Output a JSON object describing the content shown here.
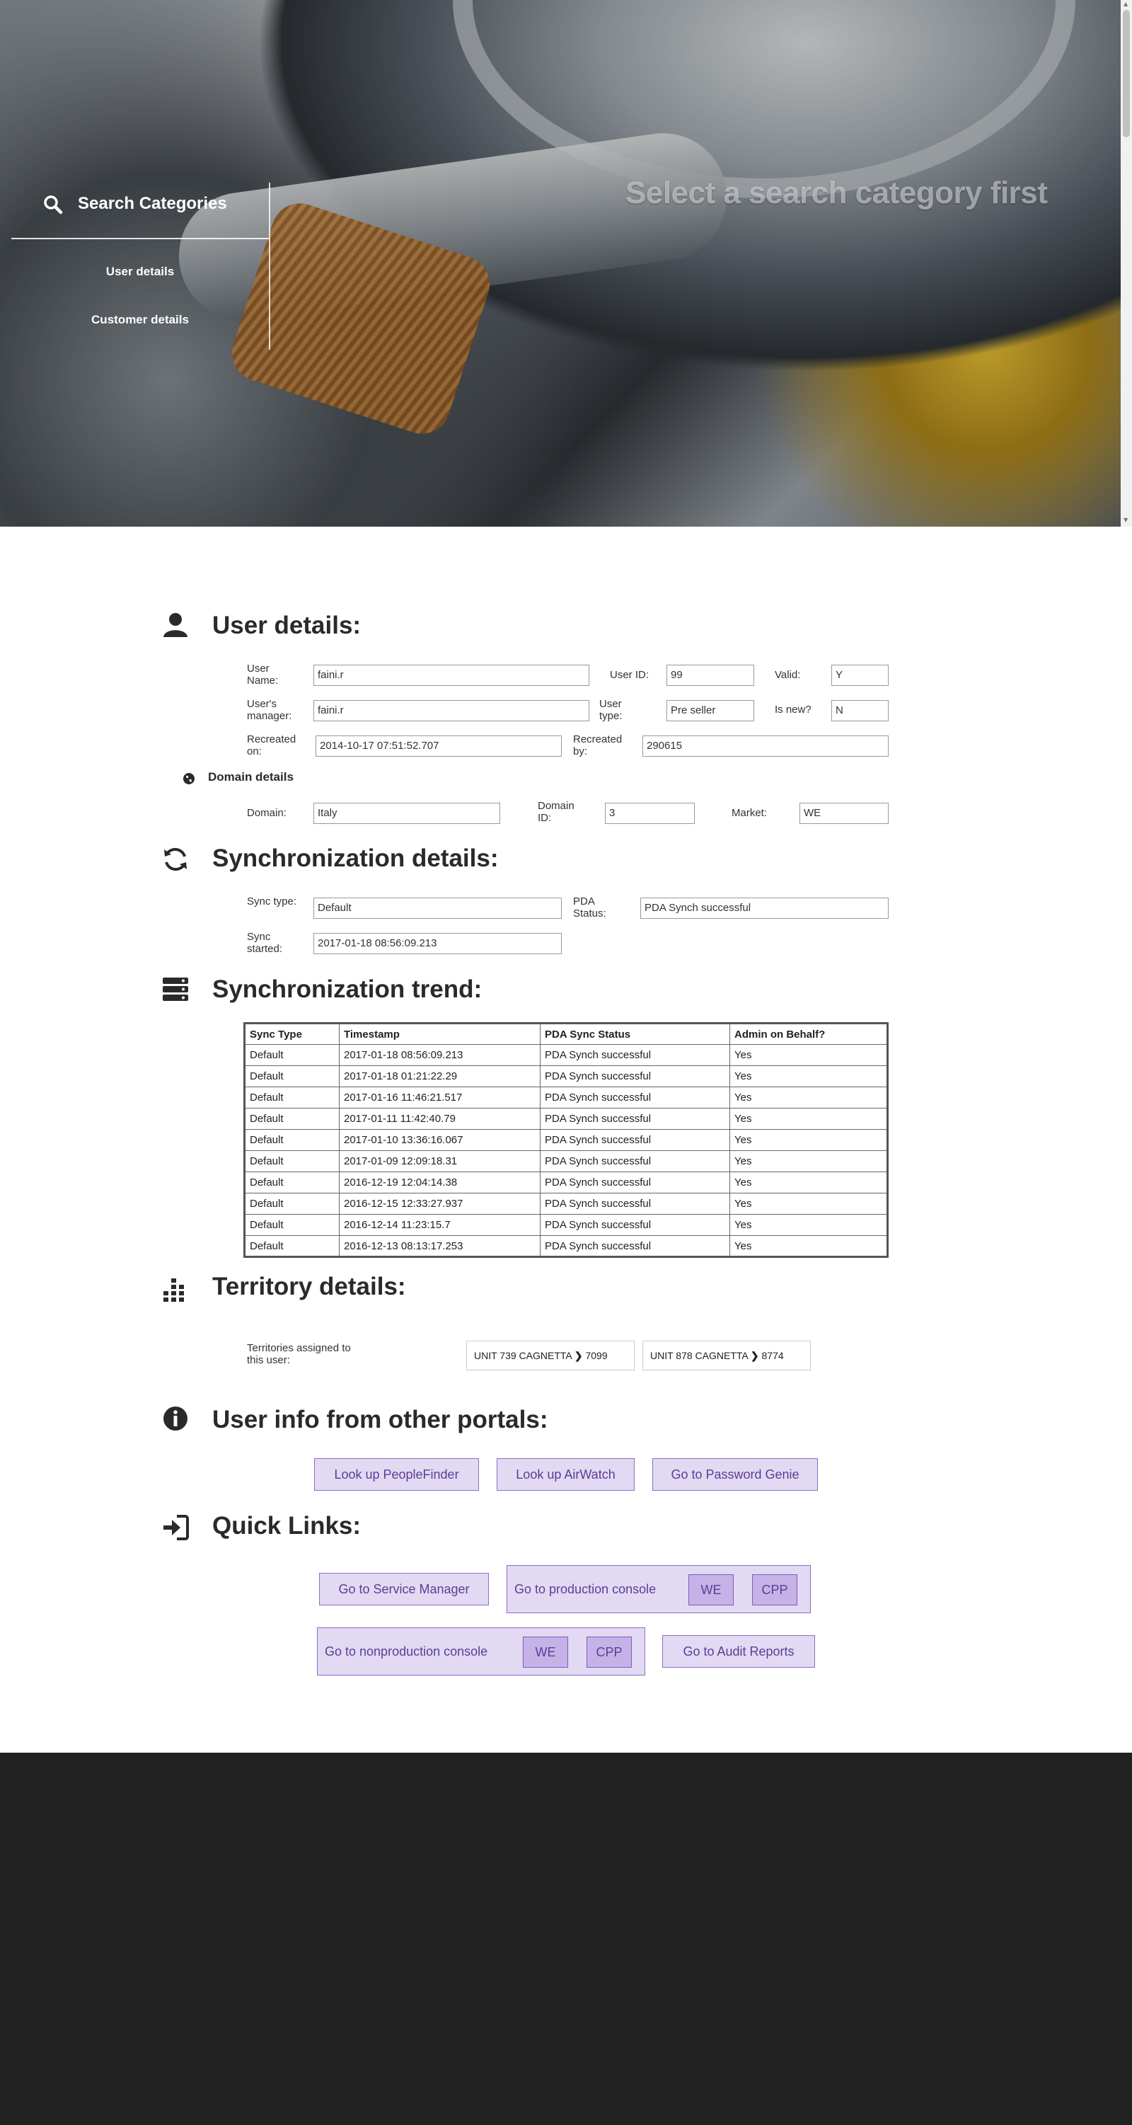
{
  "hero": {
    "title": "Select a search category first",
    "search_label": "Search Categories",
    "categories": [
      "User details",
      "Customer details"
    ]
  },
  "user_details": {
    "title": "User details:",
    "user_name_label": "User Name:",
    "user_name": "faini.r",
    "user_id_label": "User ID:",
    "user_id": "99",
    "valid_label": "Valid:",
    "valid": "Y",
    "manager_label": "User's manager:",
    "manager": "faini.r",
    "user_type_label": "User type:",
    "user_type": "Pre seller",
    "is_new_label": "Is new?",
    "is_new": "N",
    "recreated_on_label": "Recreated on:",
    "recreated_on": "2014-10-17 07:51:52.707",
    "recreated_by_label": "Recreated by:",
    "recreated_by": "290615"
  },
  "domain_details": {
    "title": "Domain details",
    "domain_label": "Domain:",
    "domain": "Italy",
    "domain_id_label": "Domain ID:",
    "domain_id": "3",
    "market_label": "Market:",
    "market": "WE"
  },
  "sync_details": {
    "title": "Synchronization details:",
    "sync_type_label": "Sync type:",
    "sync_type": "Default",
    "pda_status_label": "PDA Status:",
    "pda_status": "PDA Synch successful",
    "sync_started_label": "Sync started:",
    "sync_started": "2017-01-18 08:56:09.213"
  },
  "sync_trend": {
    "title": "Synchronization trend:",
    "columns": [
      "Sync Type",
      "Timestamp",
      "PDA Sync Status",
      "Admin on Behalf?"
    ],
    "rows": [
      [
        "Default",
        "2017-01-18 08:56:09.213",
        "PDA Synch successful",
        "Yes"
      ],
      [
        "Default",
        "2017-01-18 01:21:22.29",
        "PDA Synch successful",
        "Yes"
      ],
      [
        "Default",
        "2017-01-16 11:46:21.517",
        "PDA Synch successful",
        "Yes"
      ],
      [
        "Default",
        "2017-01-11 11:42:40.79",
        "PDA Synch successful",
        "Yes"
      ],
      [
        "Default",
        "2017-01-10 13:36:16.067",
        "PDA Synch successful",
        "Yes"
      ],
      [
        "Default",
        "2017-01-09 12:09:18.31",
        "PDA Synch successful",
        "Yes"
      ],
      [
        "Default",
        "2016-12-19 12:04:14.38",
        "PDA Synch successful",
        "Yes"
      ],
      [
        "Default",
        "2016-12-15 12:33:27.937",
        "PDA Synch successful",
        "Yes"
      ],
      [
        "Default",
        "2016-12-14 11:23:15.7",
        "PDA Synch successful",
        "Yes"
      ],
      [
        "Default",
        "2016-12-13 08:13:17.253",
        "PDA Synch successful",
        "Yes"
      ]
    ]
  },
  "territory": {
    "title": "Territory details:",
    "assigned_label": "Territories assigned to this user:",
    "items": [
      {
        "name": "UNIT 739 CAGNETTA",
        "code": "7099"
      },
      {
        "name": "UNIT 878 CAGNETTA",
        "code": "8774"
      }
    ]
  },
  "portals": {
    "title": "User info from other portals:",
    "buttons": [
      "Look up PeopleFinder",
      "Look up AirWatch",
      "Go to Password Genie"
    ]
  },
  "quick_links": {
    "title": "Quick Links:",
    "service_manager": "Go to Service Manager",
    "production_console": "Go to production console",
    "nonproduction_console": "Go to nonproduction console",
    "audit_reports": "Go to Audit Reports",
    "we": "WE",
    "cpp": "CPP"
  },
  "colors": {
    "button_bg": "#e2d9f3",
    "button_border": "#8e6cc8",
    "button_text": "#5b3e96",
    "footer_bg": "#212121"
  },
  "icons": [
    "search-icon",
    "user-icon",
    "globe-icon",
    "sync-icon",
    "server-icon",
    "territory-icon",
    "info-icon",
    "sign-in-icon",
    "chevron-right-icon"
  ]
}
